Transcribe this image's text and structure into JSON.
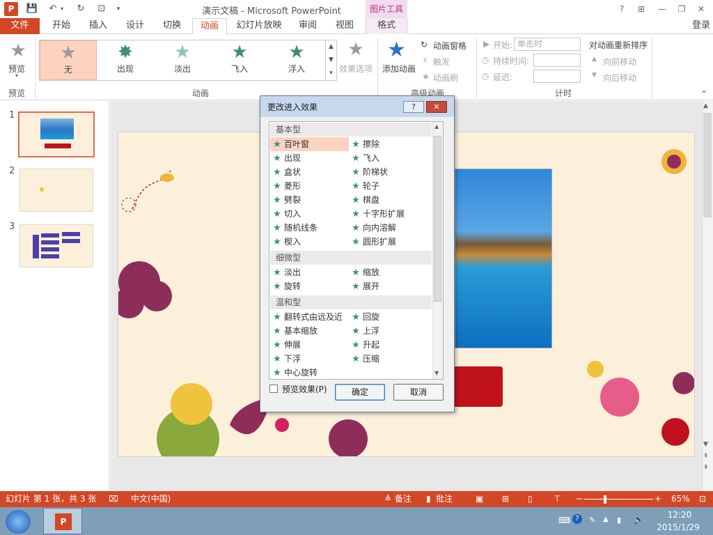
{
  "window": {
    "title": "演示文稿 - Microsoft PowerPoint",
    "context_tab": "图片工具"
  },
  "tabs": [
    "文件",
    "开始",
    "插入",
    "设计",
    "切换",
    "动画",
    "幻灯片放映",
    "审阅",
    "视图",
    "格式"
  ],
  "login": "登录",
  "ribbon": {
    "preview_label": "预览",
    "gallery": [
      "无",
      "出现",
      "淡出",
      "飞入",
      "浮入"
    ],
    "effect_options": "效果选项",
    "add_animation": "添加动画",
    "animation_pane": "动画窗格",
    "trigger": "触发",
    "painter": "动画刷",
    "start_label": "开始:",
    "start_value": "单击时",
    "duration_label": "持续时间:",
    "delay_label": "延迟:",
    "reorder_title": "对动画重新排序",
    "move_earlier": "向前移动",
    "move_later": "向后移动",
    "groups": {
      "preview": "预览",
      "animation": "动画",
      "advanced": "高级动画",
      "timing": "计时"
    }
  },
  "slides": [
    "1",
    "2",
    "3"
  ],
  "dialog": {
    "title": "更改进入效果",
    "help": "?",
    "close": "✕",
    "categories": [
      {
        "name": "基本型",
        "left": [
          "百叶窗",
          "出现",
          "盒状",
          "菱形",
          "劈裂",
          "切入",
          "随机线条",
          "楔入"
        ],
        "right": [
          "擦除",
          "飞入",
          "阶梯状",
          "轮子",
          "棋盘",
          "十字形扩展",
          "向内溶解",
          "圆形扩展"
        ]
      },
      {
        "name": "细微型",
        "left": [
          "淡出",
          "旋转"
        ],
        "right": [
          "缩放",
          "展开"
        ]
      },
      {
        "name": "温和型",
        "left": [
          "翻转式由远及近",
          "基本缩放",
          "伸展",
          "下浮",
          "中心旋转"
        ],
        "right": [
          "回旋",
          "上浮",
          "升起",
          "压缩"
        ]
      }
    ],
    "selected": "百叶窗",
    "preview_checkbox": "预览效果(P)",
    "ok": "确定",
    "cancel": "取消"
  },
  "status": {
    "slide_info": "幻灯片 第 1 张，共 3 张",
    "language": "中文(中国)",
    "notes": "备注",
    "comments": "批注",
    "zoom": "65%"
  },
  "taskbar": {
    "time": "12:20",
    "date": "2015/1/29"
  },
  "colors": {
    "accent": "#d24726",
    "star": "#3f8e7b",
    "selection": "#fbd3bf"
  }
}
